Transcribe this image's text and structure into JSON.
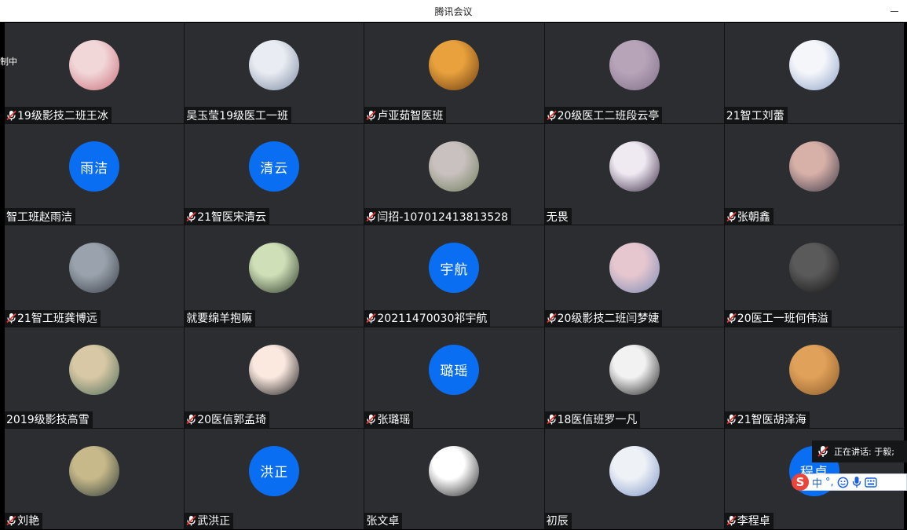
{
  "window": {
    "title": "腾讯会议"
  },
  "recording_label": "制中",
  "speaking": {
    "label": "正在讲话: 于毅;"
  },
  "ime": {
    "logo": "S",
    "lang": "中",
    "punct": "°,"
  },
  "participants": [
    {
      "name": "19级影技二班王冰",
      "muted": true,
      "avatar": "photo"
    },
    {
      "name": "吴玉莹19级医工一班",
      "muted": false,
      "avatar": "photo"
    },
    {
      "name": "卢亚茹智医班",
      "muted": true,
      "avatar": "photo"
    },
    {
      "name": "20级医工二班段云亭",
      "muted": true,
      "avatar": "photo"
    },
    {
      "name": "21智工刘蕾",
      "muted": false,
      "avatar": "photo"
    },
    {
      "name": "智工班赵雨洁",
      "muted": false,
      "avatar_text": "雨洁"
    },
    {
      "name": "21智医宋清云",
      "muted": true,
      "avatar_text": "清云"
    },
    {
      "name": "闫招-107012413813528",
      "muted": true,
      "avatar": "photo"
    },
    {
      "name": "无畏",
      "muted": false,
      "avatar": "photo"
    },
    {
      "name": "张朝鑫",
      "muted": true,
      "avatar": "photo"
    },
    {
      "name": "21智工班龚博远",
      "muted": true,
      "avatar": "photo"
    },
    {
      "name": "就要绵羊抱嘛",
      "muted": false,
      "avatar": "photo"
    },
    {
      "name": "20211470030祁宇航",
      "muted": true,
      "avatar_text": "宇航"
    },
    {
      "name": "20级影技二班闫梦婕",
      "muted": true,
      "avatar": "photo"
    },
    {
      "name": "20医工一班何伟溢",
      "muted": true,
      "avatar": "photo"
    },
    {
      "name": "2019级影技高雪",
      "muted": false,
      "avatar": "photo"
    },
    {
      "name": "20医信郭孟琦",
      "muted": true,
      "avatar": "photo"
    },
    {
      "name": "张璐瑶",
      "muted": true,
      "avatar_text": "璐瑶"
    },
    {
      "name": "18医信班罗一凡",
      "muted": true,
      "avatar": "photo"
    },
    {
      "name": "21智医胡泽海",
      "muted": true,
      "avatar": "photo"
    },
    {
      "name": "刘艳",
      "muted": true,
      "avatar": "photo"
    },
    {
      "name": "武洪正",
      "muted": true,
      "avatar_text": "洪正"
    },
    {
      "name": "张文卓",
      "muted": false,
      "avatar": "photo"
    },
    {
      "name": "初辰",
      "muted": false,
      "avatar": "photo"
    },
    {
      "name": "李程卓",
      "muted": true,
      "avatar_text": "程卓"
    }
  ],
  "colors": {
    "tile_bg": "#2b2d31",
    "avatar_blue": "#0a6ef2",
    "muted_red": "#e53935"
  }
}
